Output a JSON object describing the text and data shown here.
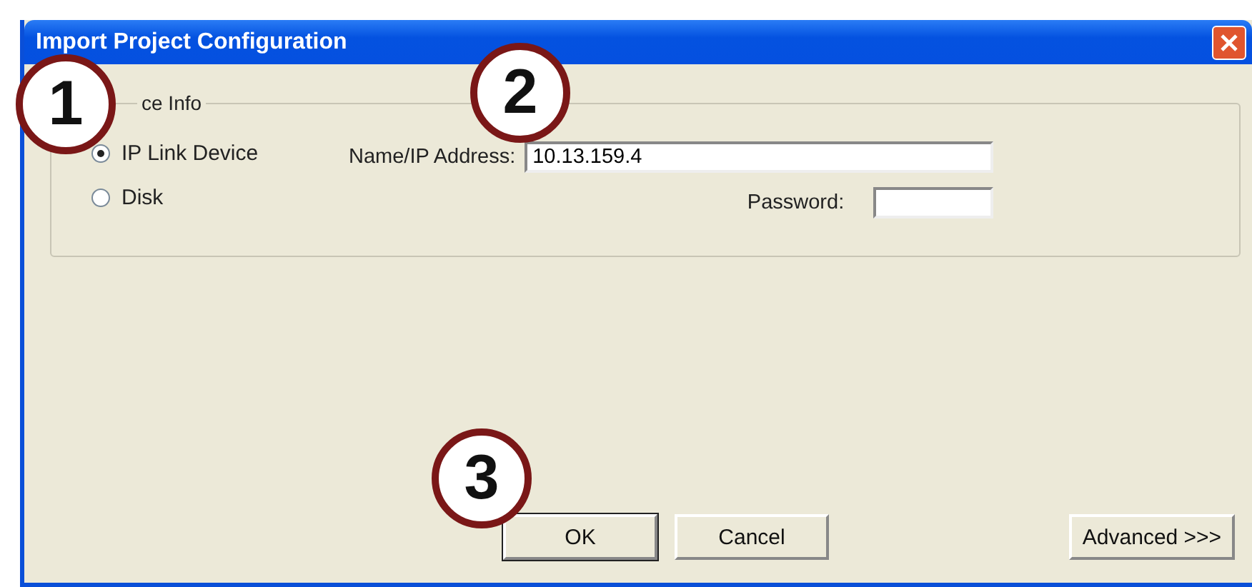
{
  "window": {
    "title": "Import Project Configuration"
  },
  "group": {
    "label": "ce Info"
  },
  "source_options": [
    {
      "label": "IP Link Device",
      "selected": true
    },
    {
      "label": "Disk",
      "selected": false
    }
  ],
  "address": {
    "label": "Name/IP Address:",
    "value": "10.13.159.4"
  },
  "password": {
    "label": "Password:"
  },
  "buttons": [
    {
      "label": "OK",
      "default": true
    },
    {
      "label": "Cancel",
      "default": false
    }
  ],
  "advanced_button": {
    "label": "Advanced >>>"
  },
  "callouts": [
    "1",
    "2",
    "3"
  ]
}
